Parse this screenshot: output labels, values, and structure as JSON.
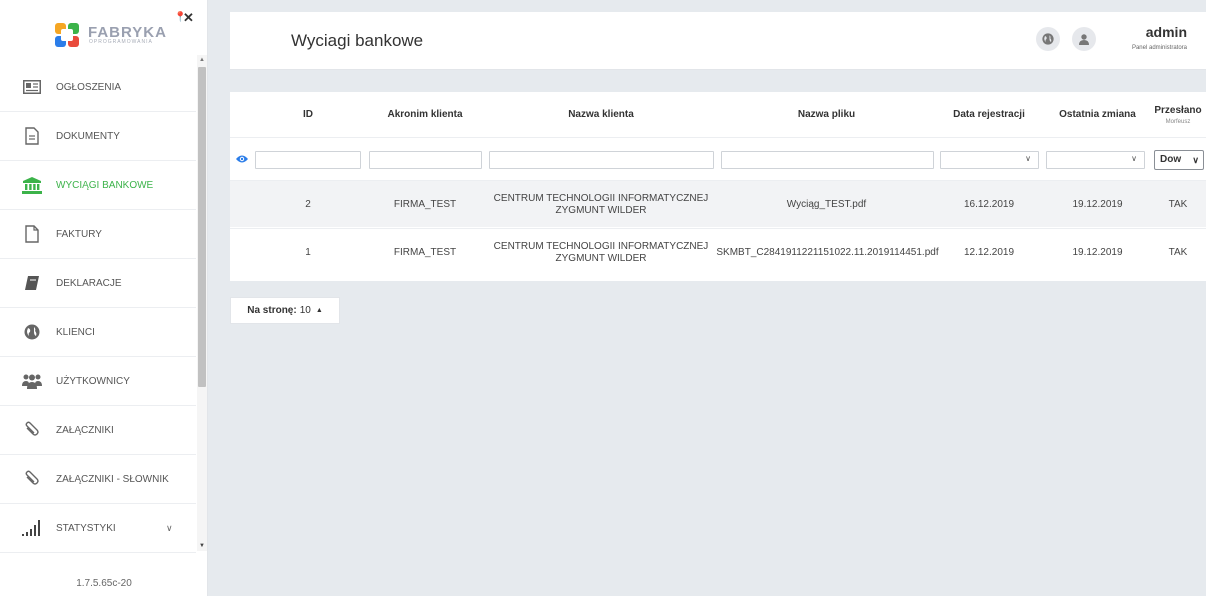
{
  "brand": {
    "name": "FABRYKA",
    "tagline": "OPROGRAMOWANIA"
  },
  "sidebar": {
    "items": [
      {
        "label": "OGŁOSZENIA",
        "icon": "newspaper-icon",
        "active": false
      },
      {
        "label": "DOKUMENTY",
        "icon": "document-icon",
        "active": false
      },
      {
        "label": "WYCIĄGI BANKOWE",
        "icon": "bank-icon",
        "active": true
      },
      {
        "label": "FAKTURY",
        "icon": "file-icon",
        "active": false
      },
      {
        "label": "DEKLARACJE",
        "icon": "book-icon",
        "active": false
      },
      {
        "label": "KLIENCI",
        "icon": "globe-icon",
        "active": false
      },
      {
        "label": "UŻYTKOWNICY",
        "icon": "users-icon",
        "active": false
      },
      {
        "label": "ZAŁĄCZNIKI",
        "icon": "paperclip-icon",
        "active": false
      },
      {
        "label": "ZAŁĄCZNIKI - SŁOWNIK",
        "icon": "paperclip-icon",
        "active": false
      },
      {
        "label": "STATYSTYKI",
        "icon": "bar-chart-icon",
        "active": false
      }
    ],
    "version": "1.7.5.65c-20"
  },
  "header": {
    "title": "Wyciagi bankowe",
    "user": {
      "name": "admin",
      "role": "Panel administratora"
    }
  },
  "table": {
    "columns": {
      "id": "ID",
      "acronym": "Akronim klienta",
      "client": "Nazwa klienta",
      "file": "Nazwa pliku",
      "registered": "Data rejestracji",
      "modified": "Ostatnia zmiana",
      "sent": "Przesłano",
      "sent_sub": "Morfeusz"
    },
    "filters": {
      "sent_select": "Dow"
    },
    "rows": [
      {
        "id": "2",
        "acronym": "FIRMA_TEST",
        "client_l1": "CENTRUM TECHNOLOGII INFORMATYCZNEJ",
        "client_l2": "ZYGMUNT WILDER",
        "file": "Wyciąg_TEST.pdf",
        "registered": "16.12.2019",
        "modified": "19.12.2019",
        "sent": "TAK"
      },
      {
        "id": "1",
        "acronym": "FIRMA_TEST",
        "client_l1": "CENTRUM TECHNOLOGII INFORMATYCZNEJ",
        "client_l2": "ZYGMUNT WILDER",
        "file": "SKMBT_C2841911221151022.11.2019114451.pdf",
        "registered": "12.12.2019",
        "modified": "19.12.2019",
        "sent": "TAK"
      }
    ]
  },
  "pagination": {
    "label": "Na stronę:",
    "value": "10"
  },
  "colors": {
    "accent": "#3cb34a",
    "background": "#e6eaee"
  }
}
